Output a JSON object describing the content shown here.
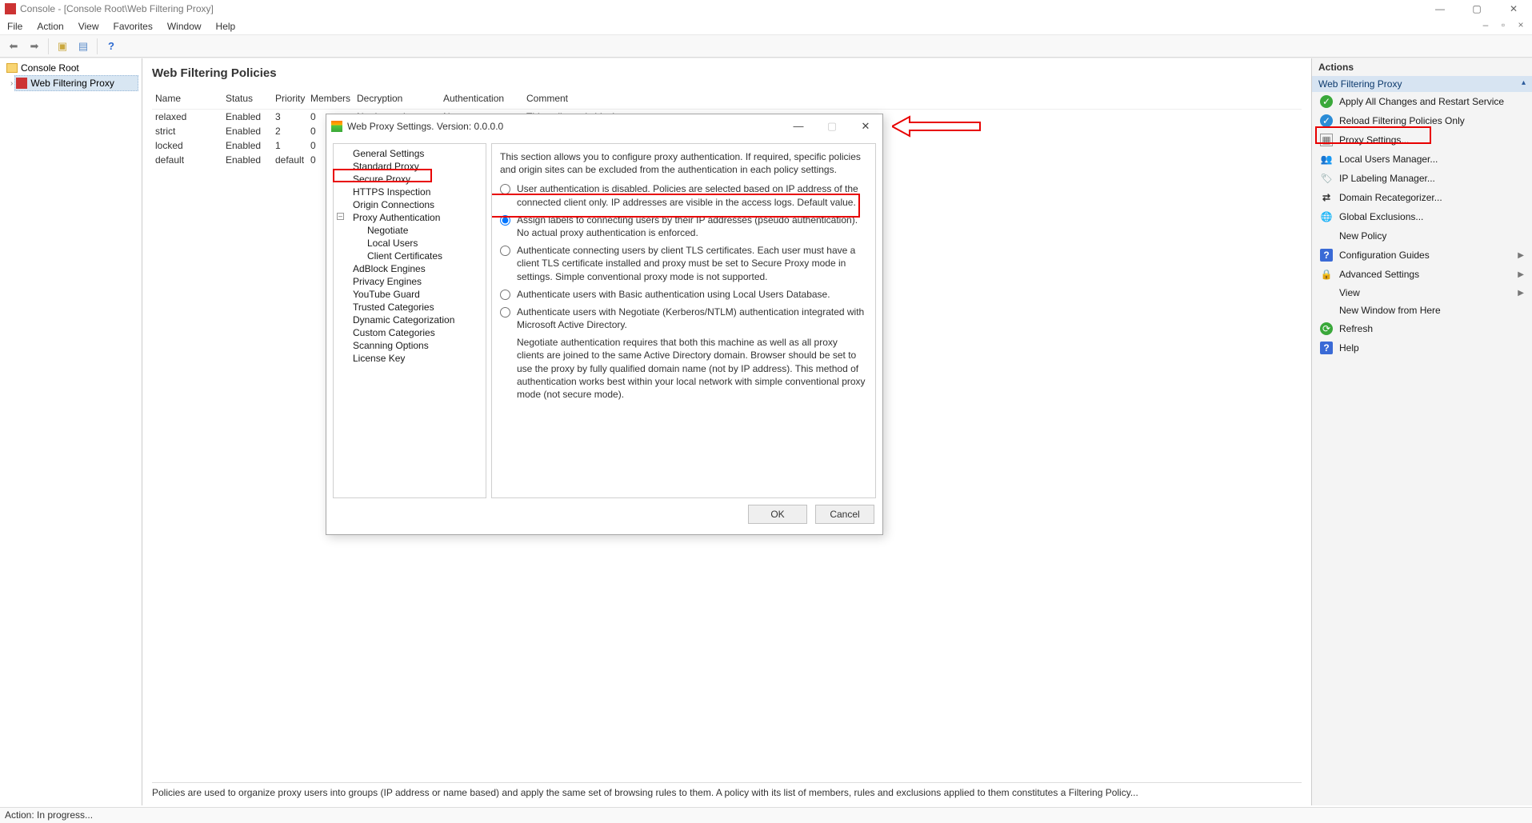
{
  "window": {
    "title": "Console - [Console Root\\Web Filtering Proxy]"
  },
  "menu": [
    "File",
    "Action",
    "View",
    "Favorites",
    "Window",
    "Help"
  ],
  "tree": {
    "root": "Console Root",
    "child": "Web Filtering Proxy"
  },
  "center": {
    "heading": "Web Filtering Policies",
    "columns": [
      "Name",
      "Status",
      "Priority",
      "Members",
      "Decryption",
      "Authentication",
      "Comment"
    ],
    "rows": [
      {
        "name": "relaxed",
        "status": "Enabled",
        "priority": "3",
        "members": "0",
        "decryption": "No decryption",
        "auth": "None",
        "comment": "This policy only block..."
      },
      {
        "name": "strict",
        "status": "Enabled",
        "priority": "2",
        "members": "0",
        "decryption": "",
        "auth": "",
        "comment": ""
      },
      {
        "name": "locked",
        "status": "Enabled",
        "priority": "1",
        "members": "0",
        "decryption": "",
        "auth": "",
        "comment": ""
      },
      {
        "name": "default",
        "status": "Enabled",
        "priority": "default",
        "members": "0",
        "decryption": "",
        "auth": "",
        "comment": ""
      }
    ],
    "note": "Policies are used to organize proxy users into groups (IP address or name based) and apply the same set of browsing rules to them. A policy with its list of members, rules and exclusions applied to them constitutes a Filtering Policy..."
  },
  "actions": {
    "header": "Actions",
    "group": "Web Filtering Proxy",
    "items": [
      "Apply All Changes and Restart Service",
      "Reload Filtering Policies Only",
      "Proxy Settings...",
      "Local Users Manager...",
      "IP Labeling Manager...",
      "Domain Recategorizer...",
      "Global Exclusions...",
      "New Policy",
      "Configuration Guides",
      "Advanced Settings",
      "View",
      "New Window from Here",
      "Refresh",
      "Help"
    ]
  },
  "dialog": {
    "title": "Web Proxy Settings. Version: 0.0.0.0",
    "tree": [
      "General Settings",
      "Standard Proxy",
      "Secure Proxy",
      "HTTPS Inspection",
      "Origin Connections",
      "Proxy Authentication",
      "Negotiate",
      "Local Users",
      "Client Certificates",
      "AdBlock Engines",
      "Privacy Engines",
      "YouTube Guard",
      "Trusted Categories",
      "Dynamic Categorization",
      "Custom Categories",
      "Scanning Options",
      "License Key"
    ],
    "intro": "This section allows you to configure proxy authentication.  If required, specific policies and origin sites can be excluded from the authentication in each policy settings.",
    "radios": [
      "User authentication is disabled. Policies are selected based on IP address of the connected client only. IP addresses are visible in the access logs. Default value.",
      "Assign labels to connecting users by their IP addresses (pseudo authentication). No actual proxy authentication is enforced.",
      "Authenticate connecting users by client TLS certificates. Each user must have a client TLS certificate installed and proxy must be set to Secure Proxy mode in settings. Simple conventional proxy mode is not supported.",
      "Authenticate users with Basic authentication using Local Users Database.",
      "Authenticate users with Negotiate (Kerberos/NTLM) authentication integrated with Microsoft Active Directory."
    ],
    "note": "Negotiate authentication requires that both this machine as well as all proxy clients are joined to the same Active Directory domain. Browser should be set to use the proxy by fully qualified domain name (not by IP address). This method of authentication works best within your local network with simple conventional proxy mode (not secure mode).",
    "ok": "OK",
    "cancel": "Cancel"
  },
  "status": "Action:  In progress..."
}
